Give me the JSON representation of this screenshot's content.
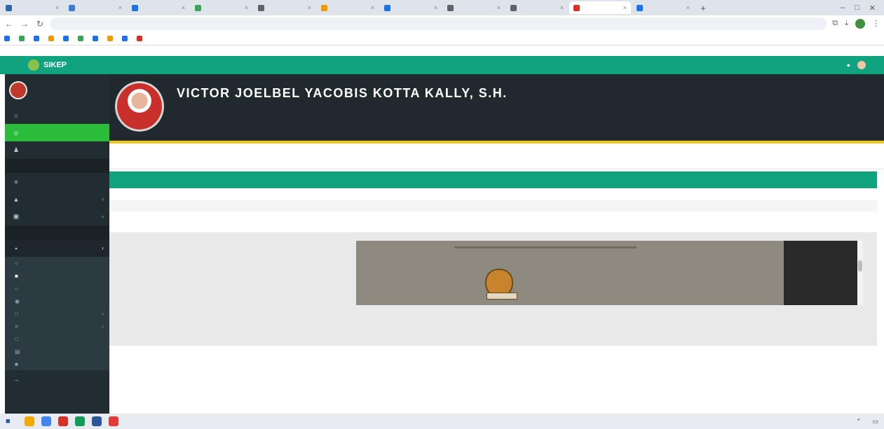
{
  "browser": {
    "tabs": [
      {
        "label": "",
        "color": "#2b6aa8"
      },
      {
        "label": "",
        "color": "#3a7bd5"
      },
      {
        "label": "",
        "color": "#1a73e8"
      },
      {
        "label": "",
        "color": "#34a853"
      },
      {
        "label": "",
        "color": "#5f6368"
      },
      {
        "label": "",
        "color": "#f29900"
      },
      {
        "label": "",
        "color": "#1a73e8"
      },
      {
        "label": "",
        "color": "#5f6368"
      },
      {
        "label": "",
        "color": "#5f6368"
      },
      {
        "label": "",
        "color": "#d93025"
      },
      {
        "label": "",
        "color": "#1a73e8"
      }
    ],
    "new_tab_label": "+",
    "url": "",
    "bookmarks": [
      {
        "label": "",
        "color": "#1a73e8"
      },
      {
        "label": "",
        "color": "#34a853"
      },
      {
        "label": "",
        "color": "#1a73e8"
      },
      {
        "label": "",
        "color": "#f29900"
      },
      {
        "label": "",
        "color": "#1a73e8"
      },
      {
        "label": "",
        "color": "#34a853"
      },
      {
        "label": "",
        "color": "#1a73e8"
      },
      {
        "label": "",
        "color": "#f29900"
      },
      {
        "label": "",
        "color": "#1a73e8"
      },
      {
        "label": "",
        "color": "#d93025"
      }
    ],
    "bookmarks_right": ""
  },
  "app": {
    "brand": "SIKEP",
    "header_user": ""
  },
  "sidebar": {
    "user_name": "",
    "items": [
      {
        "label": "",
        "icon": "home-icon",
        "glyph": "⌂",
        "active": false
      },
      {
        "label": "",
        "icon": "user-icon",
        "glyph": "☺",
        "active": true
      },
      {
        "label": "",
        "icon": "users-icon",
        "glyph": "♟",
        "active": false
      }
    ],
    "header_1": "",
    "items_2": [
      {
        "label": "",
        "icon": "chart-icon",
        "glyph": "≡"
      },
      {
        "label": "",
        "icon": "warning-icon",
        "glyph": "▲"
      },
      {
        "label": "",
        "icon": "calendar-icon",
        "glyph": "▣"
      }
    ],
    "header_2": "",
    "open_item": {
      "label": "",
      "icon": "folder-icon",
      "glyph": "▪"
    },
    "sub_items": [
      {
        "label": "",
        "glyph": "○",
        "current": false
      },
      {
        "label": "",
        "glyph": "■",
        "current": true
      },
      {
        "label": "",
        "glyph": "○",
        "current": false
      },
      {
        "label": "",
        "glyph": "◉",
        "current": false
      },
      {
        "label": "",
        "glyph": "□",
        "current": false
      },
      {
        "label": "",
        "glyph": "≡",
        "current": false
      },
      {
        "label": "",
        "glyph": "□",
        "current": false
      },
      {
        "label": "",
        "glyph": "▤",
        "current": false
      },
      {
        "label": "",
        "glyph": "■",
        "current": false
      }
    ],
    "last_item": {
      "label": "",
      "icon": "logout-icon",
      "glyph": "→"
    }
  },
  "profile": {
    "name": "VICTOR JOELBEL YACOBIS KOTTA KALLY, S.H.",
    "details": [
      "",
      "",
      "",
      ""
    ],
    "right_text": ""
  },
  "content": {
    "breadcrumb": "",
    "breadcrumb_right": "",
    "subtitle": "",
    "section_title": "",
    "rows": [
      {
        "label": "",
        "value": ""
      },
      {
        "label": "",
        "value": ""
      },
      {
        "label": "",
        "value": ""
      }
    ],
    "document_label": "",
    "footer": ""
  },
  "taskbar": {
    "search": "",
    "time": "",
    "date": ""
  }
}
